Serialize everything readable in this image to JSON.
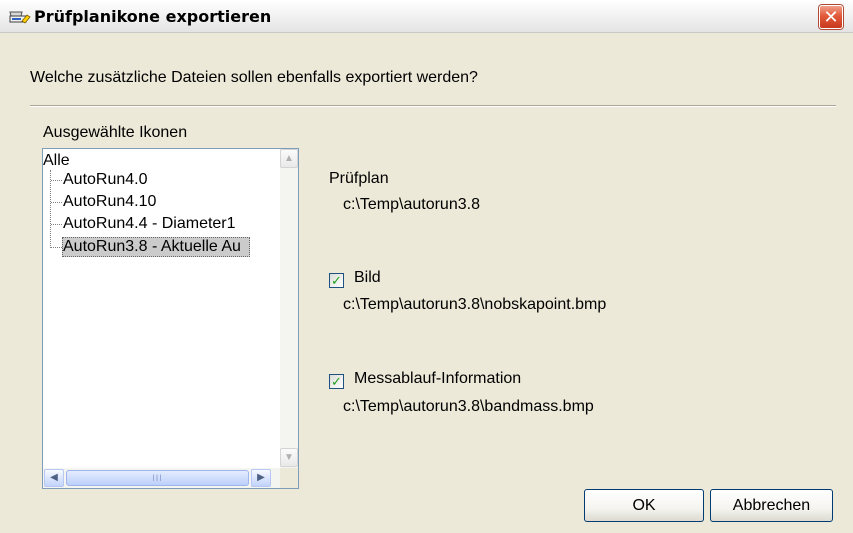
{
  "window": {
    "title": "Prüfplanikone exportieren",
    "close_symbol": "✕"
  },
  "dialog": {
    "question": "Welche zusätzliche Dateien sollen ebenfalls exportiert werden?"
  },
  "tree": {
    "label": "Ausgewählte Ikonen",
    "root": "Alle",
    "items": [
      {
        "label": "AutoRun4.0",
        "selected": false
      },
      {
        "label": "AutoRun4.10",
        "selected": false
      },
      {
        "label": "AutoRun4.4 - Diameter1",
        "selected": false
      },
      {
        "label": "AutoRun3.8 - Aktuelle Au",
        "selected": true
      }
    ],
    "scroll_thumb_grip": "III"
  },
  "details": {
    "plan": {
      "label": "Prüfplan",
      "path": "c:\\Temp\\autorun3.8"
    },
    "bild": {
      "label": "Bild",
      "checked": true,
      "path": "c:\\Temp\\autorun3.8\\nobskapoint.bmp"
    },
    "messablauf": {
      "label": "Messablauf-Information",
      "checked": true,
      "path": "c:\\Temp\\autorun3.8\\bandmass.bmp"
    }
  },
  "buttons": {
    "ok": "OK",
    "cancel": "Abbrechen"
  },
  "icons": {
    "title": "inspection-plan-icon",
    "check": "✓"
  }
}
